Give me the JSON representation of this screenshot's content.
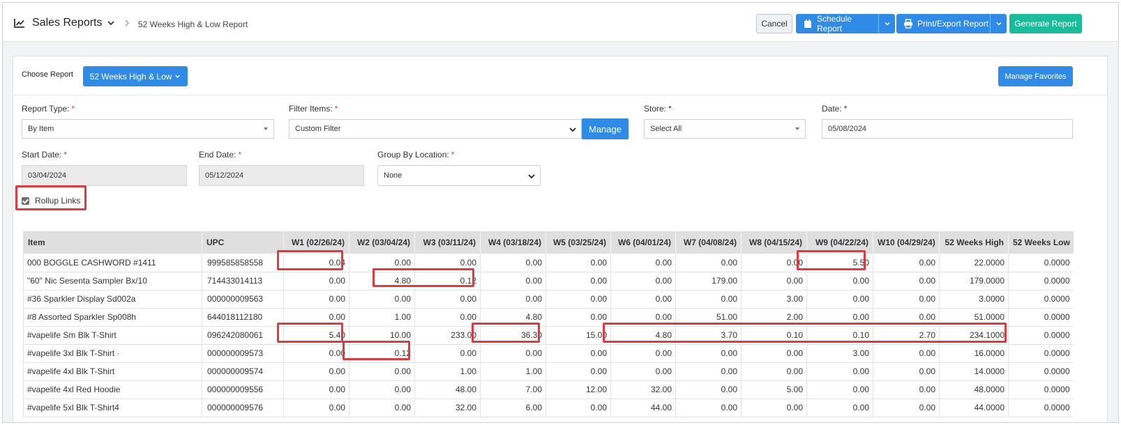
{
  "header": {
    "title": "Sales Reports",
    "breadcrumb": "52 Weeks High & Low Report",
    "buttons": {
      "cancel": "Cancel",
      "schedule": "Schedule Report",
      "print": "Print/Export Report",
      "generate": "Generate Report"
    }
  },
  "panel": {
    "choose_label": "Choose Report",
    "choose_value": "52 Weeks High & Low",
    "manage_favorites": "Manage Favorites"
  },
  "filters": {
    "report_type": {
      "label": "Report Type:",
      "required": "*",
      "value": "By Item"
    },
    "filter_items": {
      "label": "Filter Items:",
      "required": "*",
      "value": "Custom Filter",
      "manage": "Manage"
    },
    "store": {
      "label": "Store:",
      "required": "*",
      "value": "Select All"
    },
    "date": {
      "label": "Date:",
      "required": "*",
      "value": "05/08/2024"
    },
    "start_date": {
      "label": "Start Date:",
      "required": "*",
      "value": "03/04/2024"
    },
    "end_date": {
      "label": "End Date:",
      "required": "*",
      "value": "05/12/2024"
    },
    "group_by": {
      "label": "Group By Location:",
      "required": "*",
      "value": "None"
    },
    "rollup": {
      "label": "Rollup Links",
      "checked": true
    }
  },
  "table": {
    "headers": [
      "Item",
      "UPC",
      "W1 (02/26/24)",
      "W2 (03/04/24)",
      "W3 (03/11/24)",
      "W4 (03/18/24)",
      "W5 (03/25/24)",
      "W6 (04/01/24)",
      "W7 (04/08/24)",
      "W8 (04/15/24)",
      "W9 (04/22/24)",
      "W10 (04/29/24)",
      "52 Weeks High",
      "52 Weeks Low"
    ],
    "rows": [
      [
        " 000 BOGGLE CASHWORD #1411",
        "999585858558",
        "0.04",
        "0.00",
        "0.00",
        "0.00",
        "0.00",
        "0.00",
        "0.00",
        "0.00",
        "5.50",
        "0.00",
        "22.0000",
        "0.0000"
      ],
      [
        "\"60\" Nic Sesenta Sampler Bx/10",
        "714433014113",
        "0.00",
        "4.80",
        "0.12",
        "0.00",
        "0.00",
        "0.00",
        "179.00",
        "0.00",
        "0.00",
        "0.00",
        "179.0000",
        "0.0000"
      ],
      [
        "#36 Sparkler Display Sd002a",
        "000000009563",
        "0.00",
        "0.00",
        "0.00",
        "0.00",
        "0.00",
        "0.00",
        "0.00",
        "3.00",
        "0.00",
        "0.00",
        "3.0000",
        "0.0000"
      ],
      [
        "#8 Assorted Sparkler Sp008h",
        "644018112180",
        "0.00",
        "1.00",
        "0.00",
        "4.80",
        "0.00",
        "0.00",
        "51.00",
        "2.00",
        "0.00",
        "0.00",
        "51.0000",
        "0.0000"
      ],
      [
        "#vapelife Sm Blk T-Shirt",
        "096242080061",
        "5.40",
        "10.00",
        "233.00",
        "36.30",
        "15.00",
        "4.80",
        "3.70",
        "0.10",
        "0.10",
        "2.70",
        "234.1000",
        "0.0000"
      ],
      [
        "#vapelife 3xl Blk T-Shirt ·",
        "000000009573",
        "0.00",
        "0.12",
        "0.00",
        "0.00",
        "0.00",
        "0.00",
        "0.00",
        "0.00",
        "3.00",
        "0.00",
        "16.0000",
        "0.0000"
      ],
      [
        "#vapelife 4xl Blk T-Shirt",
        "000000009574",
        "0.00",
        "0.00",
        "1.00",
        "1.00",
        "0.00",
        "0.00",
        "0.00",
        "0.00",
        "0.00",
        "0.00",
        "14.0000",
        "0.0000"
      ],
      [
        "#vapelife 4xl Red Hoodie",
        "000000009556",
        "0.00",
        "0.00",
        "48.00",
        "7.00",
        "12.00",
        "32.00",
        "0.00",
        "5.00",
        "0.00",
        "0.00",
        "48.0000",
        "0.0000"
      ],
      [
        "#vapelife 5xl Blk T-Shirt4",
        "000000009576",
        "0.00",
        "0.00",
        "32.00",
        "6.00",
        "0.00",
        "44.00",
        "0.00",
        "0.00",
        "0.00",
        "0.00",
        "44.0000",
        "0.0000"
      ]
    ]
  },
  "colors": {
    "primary": "#2f8be6",
    "success": "#1bbc9b",
    "highlight": "#e0393f",
    "required": "#e03a3a"
  },
  "icons": [
    "line-chart-icon",
    "chevron-down-icon",
    "chevron-right-icon",
    "calendar-icon",
    "printer-icon"
  ]
}
